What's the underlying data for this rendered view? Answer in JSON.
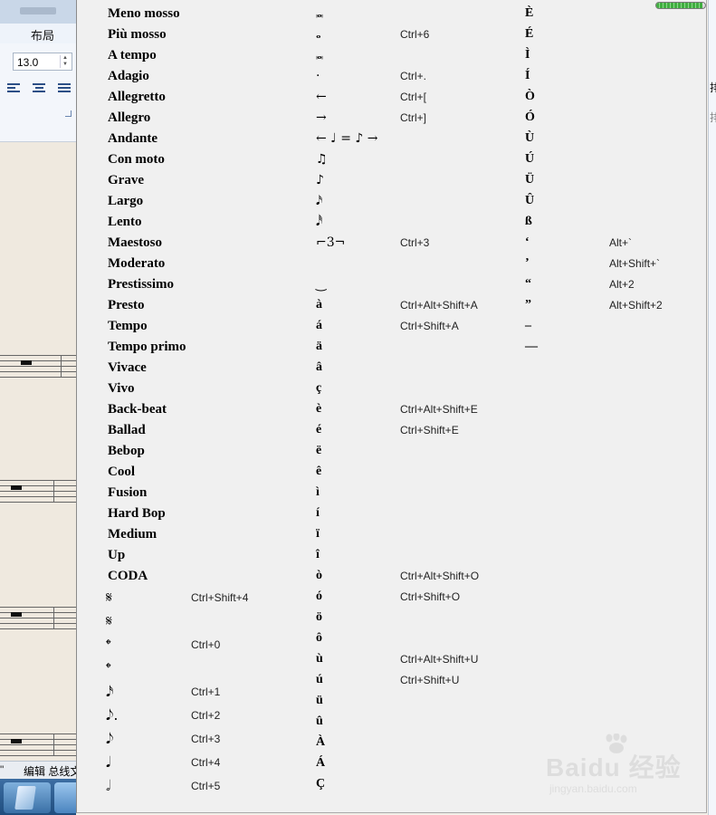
{
  "background_app": {
    "menu_label": "布局",
    "font_size_value": "13.0",
    "status_text": "编辑 总线文",
    "status_quote": "\"",
    "right_label_1": "排",
    "right_label_2": "排"
  },
  "popup": {
    "progress_fraction": 0.95,
    "tempo_labels": [
      "Meno mosso",
      "Più mosso",
      "A tempo",
      "Adagio",
      "Allegretto",
      "Allegro",
      "Andante",
      "Con moto",
      "Grave",
      "Largo",
      "Lento",
      "Maestoso",
      "Moderato",
      "Prestissimo",
      "Presto",
      "Tempo",
      "Tempo primo",
      "Vivace",
      "Vivo",
      "Back-beat",
      "Ballad",
      "Bebop",
      "Cool",
      "Fusion",
      "Hard Bop",
      "Medium",
      "Up",
      "CODA"
    ],
    "music_symbols": [
      {
        "icon": "segno-icon",
        "glyph": "𝄋",
        "shortcut": "Ctrl+Shift+4"
      },
      {
        "icon": "segno-alt-icon",
        "glyph": "𝄋",
        "shortcut": ""
      },
      {
        "icon": "coda-icon",
        "glyph": "𝄌",
        "shortcut": "Ctrl+0"
      },
      {
        "icon": "coda-alt-icon",
        "glyph": "𝄌",
        "shortcut": ""
      },
      {
        "icon": "sixteenth-note-icon",
        "glyph": "𝅘𝅥𝅯",
        "shortcut": "Ctrl+1"
      },
      {
        "icon": "dotted-eighth-note-icon",
        "glyph": "𝅘𝅥𝅮.",
        "shortcut": "Ctrl+2"
      },
      {
        "icon": "eighth-note-icon",
        "glyph": "𝅘𝅥𝅮",
        "shortcut": "Ctrl+3"
      },
      {
        "icon": "quarter-note-icon",
        "glyph": "𝅘𝅥",
        "shortcut": "Ctrl+4"
      },
      {
        "icon": "half-note-icon",
        "glyph": "𝅗𝅥",
        "shortcut": "Ctrl+5"
      }
    ],
    "col2": [
      {
        "icon": "breve-icon",
        "glyph": "𝅜",
        "shortcut": ""
      },
      {
        "icon": "whole-note-icon",
        "glyph": "𝅝",
        "shortcut": "Ctrl+6"
      },
      {
        "icon": "double-whole-note-icon",
        "glyph": "𝅜",
        "shortcut": ""
      },
      {
        "icon": "dot-icon",
        "glyph": "·",
        "shortcut": "Ctrl+."
      },
      {
        "icon": "left-arrow-icon",
        "glyph": "←",
        "shortcut": "Ctrl+["
      },
      {
        "icon": "right-arrow-icon",
        "glyph": "→",
        "shortcut": "Ctrl+]"
      },
      {
        "icon": "metric-modulation-icon",
        "glyph": "← ♩ = ♪ →",
        "shortcut": ""
      },
      {
        "icon": "beamed-eighths-icon",
        "glyph": "♫",
        "shortcut": ""
      },
      {
        "icon": "flagged-eighth-icon",
        "glyph": "♪",
        "shortcut": ""
      },
      {
        "icon": "flagged-sixteenth-icon",
        "glyph": "𝅘𝅥𝅯",
        "shortcut": ""
      },
      {
        "icon": "flagged-thirtysecond-icon",
        "glyph": "𝅘𝅥𝅰",
        "shortcut": ""
      },
      {
        "icon": "triplet-bracket-icon",
        "glyph": "⌐3¬",
        "shortcut": "Ctrl+3"
      },
      {
        "icon": "blank-icon",
        "glyph": "",
        "shortcut": ""
      },
      {
        "icon": "tie-icon",
        "glyph": "‿",
        "shortcut": ""
      },
      {
        "icon": "a-grave-icon",
        "glyph": "à",
        "shortcut": "Ctrl+Alt+Shift+A"
      },
      {
        "icon": "a-acute-icon",
        "glyph": "á",
        "shortcut": "Ctrl+Shift+A"
      },
      {
        "icon": "a-umlaut-icon",
        "glyph": "ä",
        "shortcut": ""
      },
      {
        "icon": "a-circumflex-icon",
        "glyph": "â",
        "shortcut": ""
      },
      {
        "icon": "c-cedilla-icon",
        "glyph": "ç",
        "shortcut": ""
      },
      {
        "icon": "e-grave-icon",
        "glyph": "è",
        "shortcut": "Ctrl+Alt+Shift+E"
      },
      {
        "icon": "e-acute-icon",
        "glyph": "é",
        "shortcut": "Ctrl+Shift+E"
      },
      {
        "icon": "e-umlaut-icon",
        "glyph": "ë",
        "shortcut": ""
      },
      {
        "icon": "e-circumflex-icon",
        "glyph": "ê",
        "shortcut": ""
      },
      {
        "icon": "i-grave-icon",
        "glyph": "ì",
        "shortcut": ""
      },
      {
        "icon": "i-acute-icon",
        "glyph": "í",
        "shortcut": ""
      },
      {
        "icon": "i-umlaut-icon",
        "glyph": "ï",
        "shortcut": ""
      },
      {
        "icon": "i-circumflex-icon",
        "glyph": "î",
        "shortcut": ""
      },
      {
        "icon": "o-grave-icon",
        "glyph": "ò",
        "shortcut": "Ctrl+Alt+Shift+O"
      },
      {
        "icon": "o-acute-icon",
        "glyph": "ó",
        "shortcut": "Ctrl+Shift+O"
      },
      {
        "icon": "o-umlaut-icon",
        "glyph": "ö",
        "shortcut": ""
      },
      {
        "icon": "o-circumflex-icon",
        "glyph": "ô",
        "shortcut": ""
      },
      {
        "icon": "u-grave-icon",
        "glyph": "ù",
        "shortcut": "Ctrl+Alt+Shift+U"
      },
      {
        "icon": "u-acute-icon",
        "glyph": "ú",
        "shortcut": "Ctrl+Shift+U"
      },
      {
        "icon": "u-umlaut-icon",
        "glyph": "ü",
        "shortcut": ""
      },
      {
        "icon": "u-circumflex-icon",
        "glyph": "û",
        "shortcut": ""
      },
      {
        "icon": "A-grave-icon",
        "glyph": "À",
        "shortcut": ""
      },
      {
        "icon": "A-acute-icon",
        "glyph": "Á",
        "shortcut": ""
      },
      {
        "icon": "C-cedilla-icon",
        "glyph": "Ç",
        "shortcut": ""
      }
    ],
    "col3": [
      {
        "icon": "E-grave-icon",
        "glyph": "È",
        "shortcut": ""
      },
      {
        "icon": "E-acute-icon",
        "glyph": "É",
        "shortcut": ""
      },
      {
        "icon": "I-grave-icon",
        "glyph": "Ì",
        "shortcut": ""
      },
      {
        "icon": "I-acute-icon",
        "glyph": "Í",
        "shortcut": ""
      },
      {
        "icon": "O-grave-icon",
        "glyph": "Ò",
        "shortcut": ""
      },
      {
        "icon": "O-acute-icon",
        "glyph": "Ó",
        "shortcut": ""
      },
      {
        "icon": "U-grave-icon",
        "glyph": "Ù",
        "shortcut": ""
      },
      {
        "icon": "U-acute-icon",
        "glyph": "Ú",
        "shortcut": ""
      },
      {
        "icon": "U-umlaut-icon",
        "glyph": "Ü",
        "shortcut": ""
      },
      {
        "icon": "U-circumflex-icon",
        "glyph": "Û",
        "shortcut": ""
      },
      {
        "icon": "sharp-s-icon",
        "glyph": "ß",
        "shortcut": ""
      },
      {
        "icon": "left-single-quote-icon",
        "glyph": "‘",
        "shortcut": "Alt+`"
      },
      {
        "icon": "right-single-quote-icon",
        "glyph": "’",
        "shortcut": "Alt+Shift+`"
      },
      {
        "icon": "left-double-quote-icon",
        "glyph": "“",
        "shortcut": "Alt+2"
      },
      {
        "icon": "right-double-quote-icon",
        "glyph": "”",
        "shortcut": "Alt+Shift+2"
      },
      {
        "icon": "en-dash-icon",
        "glyph": "–",
        "shortcut": ""
      },
      {
        "icon": "em-dash-icon",
        "glyph": "—",
        "shortcut": ""
      }
    ]
  },
  "watermark": {
    "brand": "Baidu",
    "brand_cn": "经验",
    "url": "jingyan.baidu.com"
  }
}
